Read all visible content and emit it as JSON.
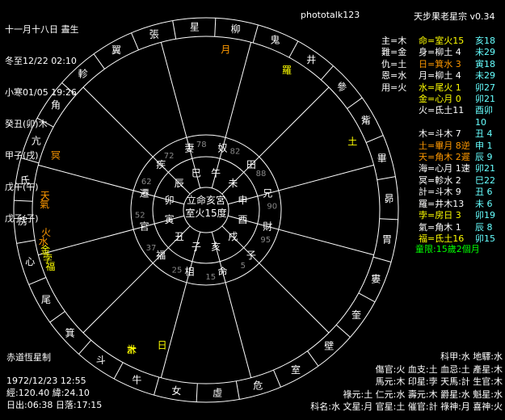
{
  "header": {
    "lines": [
      "十一月十八日 晝生",
      "冬至12/22 02:10",
      "小寒01/05 19:26",
      "癸丑(卯)木",
      "甲子(戌)",
      "戊午(午)",
      "戊子(子)"
    ],
    "title": "phototalk123",
    "app": "天步果老星宗 v0.34"
  },
  "right_table": [
    {
      "a": "主=木",
      "b": "命=室火15",
      "c": "亥18",
      "color": "y"
    },
    {
      "a": "難=金",
      "b": "身=柳土 4",
      "c": "未29",
      "color": "w"
    },
    {
      "a": "仇=土",
      "b": "日=箕水 3",
      "c": "寅18",
      "color": "o"
    },
    {
      "a": "恩=水",
      "b": "月=柳土 4",
      "c": "未29",
      "color": "w"
    },
    {
      "a": "用=火",
      "b": "水=尾火 1",
      "c": "卯27",
      "color": "y"
    },
    {
      "a": "",
      "b": "金=心月 0",
      "c": "卯21",
      "color": "y"
    },
    {
      "a": "",
      "b": "火=氐土11",
      "c": "酉卯10",
      "color": "w"
    },
    {
      "a": "",
      "b": "木=斗木 7",
      "c": "丑 4",
      "color": "w"
    },
    {
      "a": "",
      "b": "土=畢月 8逆",
      "c": "申 1",
      "color": "o"
    },
    {
      "a": "",
      "b": "天=角木 2遲",
      "c": "辰 9",
      "color": "o"
    },
    {
      "a": "",
      "b": "海=心月 1速",
      "c": "卯21",
      "color": "w"
    },
    {
      "a": "",
      "b": "冥=軫水 2",
      "c": "巳22",
      "color": "w"
    },
    {
      "a": "",
      "b": "計=斗木 9",
      "c": "丑 6",
      "color": "w"
    },
    {
      "a": "",
      "b": "羅=井木13",
      "c": "未 6",
      "color": "w"
    },
    {
      "a": "",
      "b": "孛=房日 3",
      "c": "卯19",
      "color": "y"
    },
    {
      "a": "",
      "b": "氣=角木 1",
      "c": "辰 8",
      "color": "w"
    },
    {
      "a": "",
      "b": "福=氐土16",
      "c": "卯15",
      "color": "y"
    }
  ],
  "tonglin": "童限:15歲2個月",
  "bottom_left_title": "赤道恆星制",
  "birth": [
    "1972/12/23 12:55",
    "經:120.40 緯:24.10",
    "日出:06:38 日落:17:15"
  ],
  "bottom_right": [
    "科甲:水 地驛:水",
    "傷官:火 血支:土 血忌:土 產星:木",
    "馬元:木 印星:孛 天馬:計 生官:木",
    "祿元:土 仁元:水 壽元:木 爵星:水 魁星:水",
    "科名:水 文星:月 官星:土 催官:計 祿神:月 喜神:火"
  ],
  "outer_mansions": [
    "星",
    "柳",
    "鬼",
    "井",
    "參",
    "觜",
    "畢",
    "昴",
    "胃",
    "婁",
    "奎",
    "壁",
    "室",
    "危",
    "虛",
    "女",
    "牛",
    "斗",
    "箕",
    "尾",
    "心",
    "房",
    "氐",
    "亢",
    "角",
    "軫",
    "翼",
    "張"
  ],
  "palaces": [
    "命",
    "相",
    "福",
    "官",
    "遷",
    "疾",
    "妻",
    "奴",
    "田",
    "兄",
    "財",
    "子"
  ],
  "branches": [
    "亥",
    "子",
    "丑",
    "寅",
    "卯",
    "辰",
    "巳",
    "午",
    "未",
    "申",
    "酉",
    "戌"
  ],
  "ages": [
    "15",
    "25",
    "37",
    "52",
    "62",
    "72",
    "78",
    "82",
    "88",
    "90",
    "95",
    "5"
  ],
  "center": [
    "立命亥宮",
    "室火15度"
  ],
  "stars_in_chart": [
    "月",
    "羅",
    "土",
    "火",
    "木",
    "計",
    "日",
    "冥",
    "天",
    "氣",
    "福",
    "孛",
    "金",
    "水"
  ]
}
